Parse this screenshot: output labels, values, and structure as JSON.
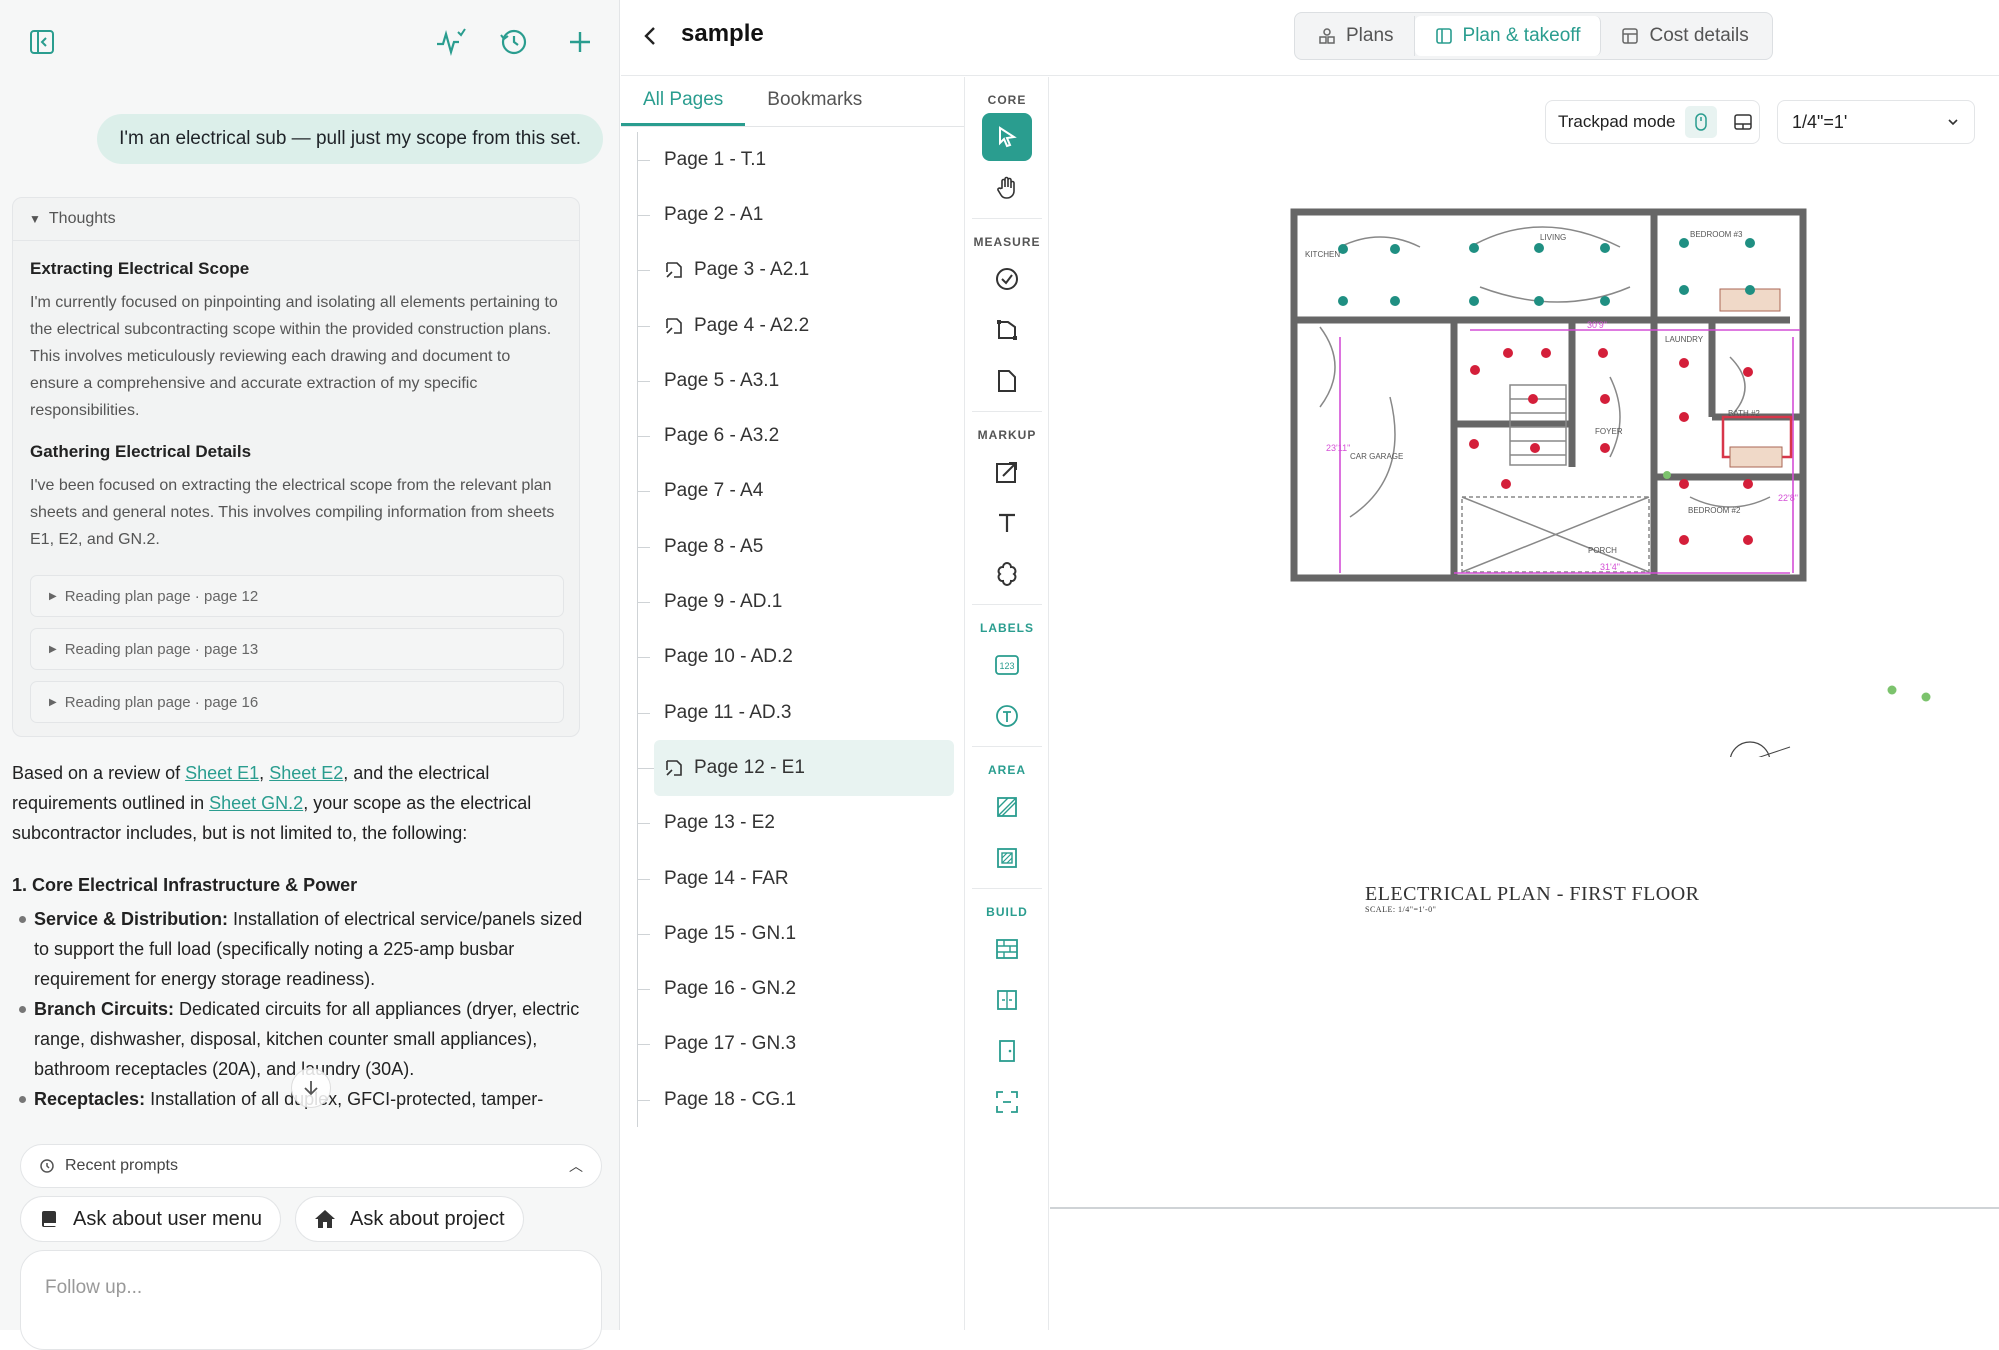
{
  "chat": {
    "user_message": "I'm an electrical sub — pull just my scope from this set.",
    "thoughts": {
      "label": "Thoughts",
      "sections": [
        {
          "title": "Extracting Electrical Scope",
          "body": "I'm currently focused on pinpointing and isolating all elements pertaining to the electrical subcontracting scope within the provided construction plans. This involves meticulously reviewing each drawing and document to ensure a comprehensive and accurate extraction of my specific responsibilities."
        },
        {
          "title": "Gathering Electrical Details",
          "body": "I've been focused on extracting the electrical scope from the relevant plan sheets and general notes. This involves compiling information from sheets E1, E2, and GN.2."
        }
      ],
      "tool_calls": [
        "Reading plan page · page 12",
        "Reading plan page · page 13",
        "Reading plan page · page 16"
      ]
    },
    "answer": {
      "intro_1": "Based on a review of ",
      "link_1": "Sheet E1",
      "sep_1": ", ",
      "link_2": "Sheet E2",
      "intro_2": ", and the electrical requirements outlined in ",
      "link_3": "Sheet GN.2",
      "intro_3": ", your scope as the electrical subcontractor includes, but is not limited to, the following:",
      "section_1_title": "1. Core Electrical Infrastructure & Power",
      "bullets": [
        {
          "bold": "Service & Distribution:",
          "text": " Installation of electrical service/panels sized to support the full load (specifically noting a 225-amp busbar requirement for energy storage readiness)."
        },
        {
          "bold": "Branch Circuits:",
          "text": " Dedicated circuits for all appliances (dryer, electric range, dishwasher, disposal, kitchen counter small appliances), bathroom receptacles (20A), and laundry (30A)."
        },
        {
          "bold": "Receptacles:",
          "text": " Installation of all duplex, GFCI-protected, tamper-"
        }
      ]
    },
    "recent_prompts_label": "Recent prompts",
    "chips": [
      "Ask about user menu",
      "Ask about project"
    ],
    "followup_placeholder": "Follow up..."
  },
  "header": {
    "title": "sample",
    "tabs": [
      "Plans",
      "Plan & takeoff",
      "Cost details"
    ],
    "active_tab": "Plan & takeoff"
  },
  "pages": {
    "tabs": [
      "All Pages",
      "Bookmarks"
    ],
    "items": [
      "Page 1 - T.1",
      "Page 2 - A1",
      "Page 3 - A2.1",
      "Page 4 - A2.2",
      "Page 5 - A3.1",
      "Page 6 - A3.2",
      "Page 7 - A4",
      "Page 8 - A5",
      "Page 9 - AD.1",
      "Page 10 - AD.2",
      "Page 11 - AD.3",
      "Page 12 - E1",
      "Page 13 - E2",
      "Page 14 - FAR",
      "Page 15 - GN.1",
      "Page 16 - GN.2",
      "Page 17 - GN.3",
      "Page 18 - CG.1"
    ],
    "active": "Page 12 - E1"
  },
  "tools": {
    "sections": [
      "CORE",
      "MEASURE",
      "MARKUP",
      "LABELS",
      "AREA",
      "BUILD"
    ]
  },
  "canvas": {
    "trackpad_label": "Trackpad mode",
    "scale_value": "1/4\"=1'",
    "plan_title": "ELECTRICAL PLAN - FIRST FLOOR",
    "plan_scale_note": "SCALE: 1/4\"=1'-0\"",
    "room_labels": [
      "LIVING",
      "KITCHEN",
      "BEDROOM #3",
      "CAR GARAGE",
      "FOYER",
      "BEDROOM #2",
      "BATH #2",
      "LAUNDRY",
      "PORCH"
    ],
    "dimensions": [
      "30'9\"",
      "23'11\"",
      "31'4\"",
      "22'8\""
    ]
  },
  "colors": {
    "accent": "#2a9d8f",
    "accent_light": "#e8f3f1",
    "receptacle_red": "#d41f3a",
    "fixture_teal": "#1f8f82",
    "dimension_magenta": "#d44fd6"
  }
}
